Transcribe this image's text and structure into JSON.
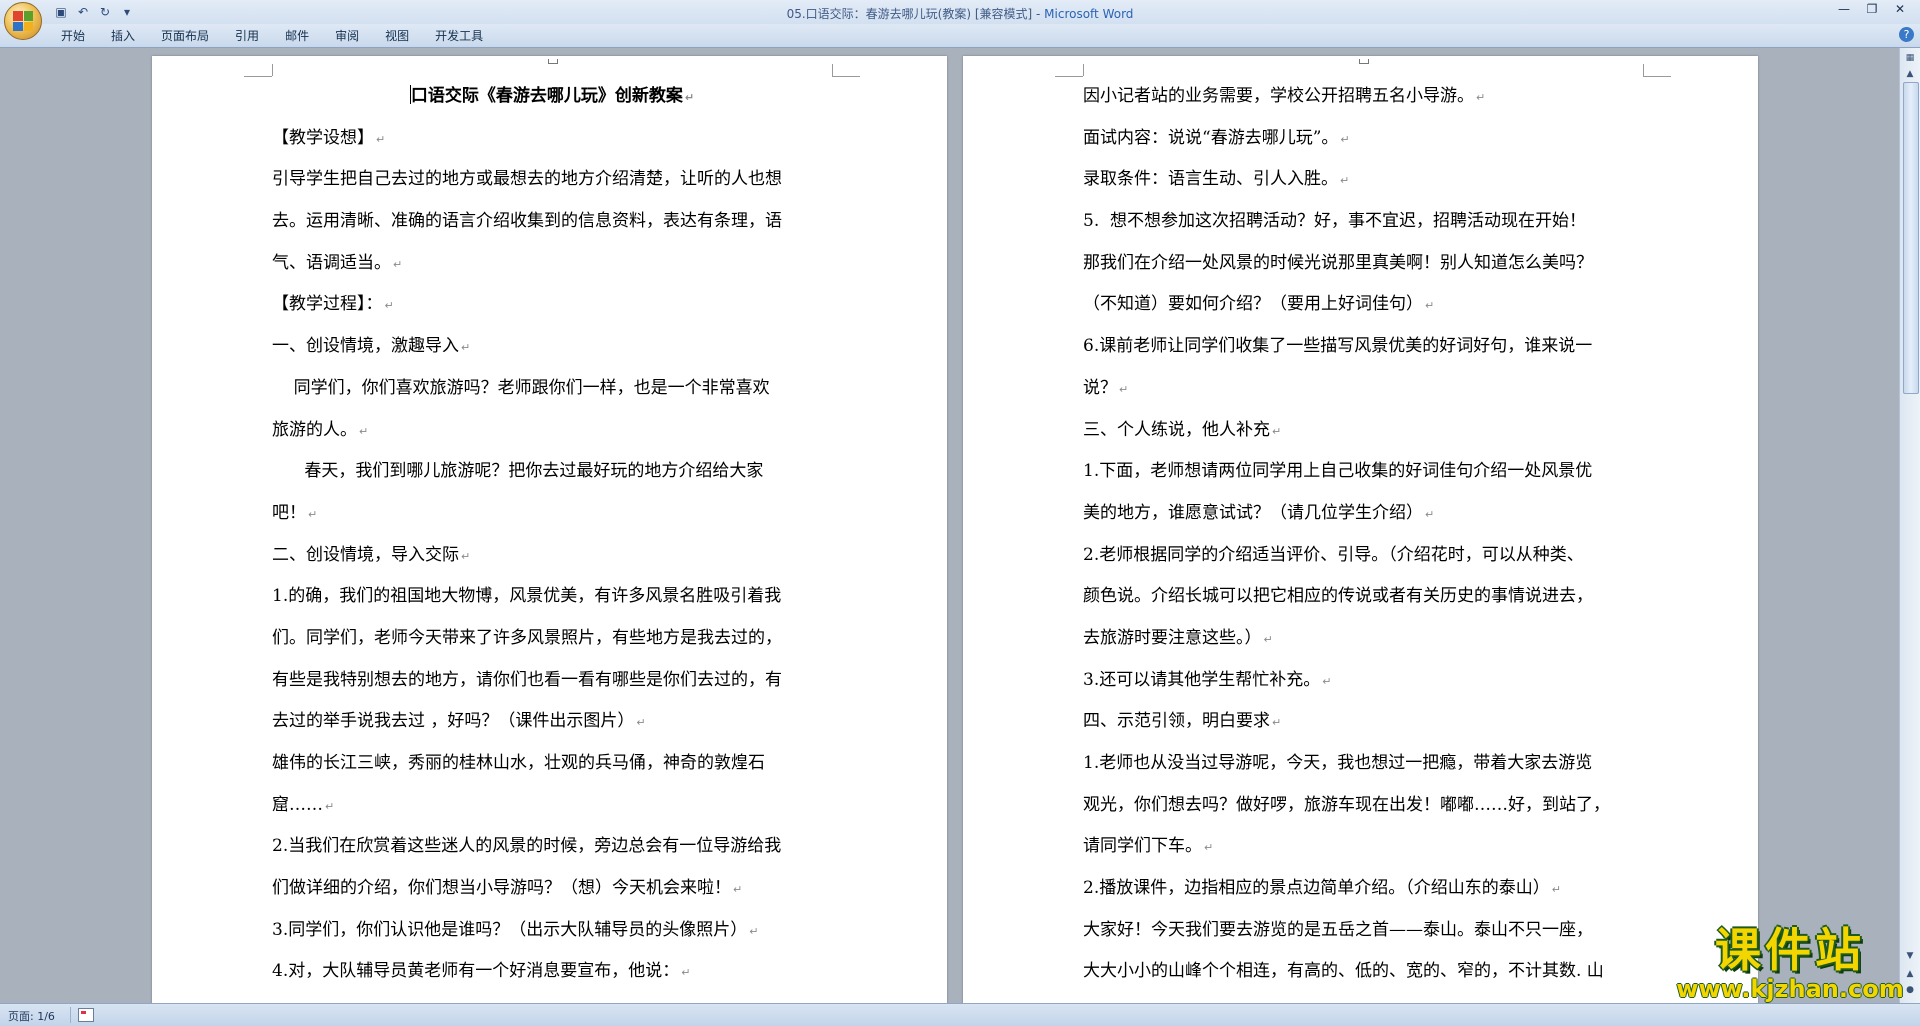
{
  "window": {
    "doc_title": "05.口语交际：春游去哪儿玩(教案) [兼容模式] - ",
    "app_name": "Microsoft Word"
  },
  "qat": {
    "save_icon": "save-icon",
    "undo_icon": "undo-icon",
    "redo_icon": "redo-icon"
  },
  "ribbon": {
    "tabs": [
      "开始",
      "插入",
      "页面布局",
      "引用",
      "邮件",
      "审阅",
      "视图",
      "开发工具"
    ]
  },
  "page_left": {
    "lines": [
      "口语交际《春游去哪儿玩》创新教案",
      "【教学设想】",
      "引导学生把自己去过的地方或最想去的地方介绍清楚，让听的人也想",
      "去。运用清晰、准确的语言介绍收集到的信息资料，表达有条理，语",
      "气、语调适当。",
      "【教学过程】：",
      "一、创设情境，激趣导入",
      "    同学们，你们喜欢旅游吗？老师跟你们一样，也是一个非常喜欢",
      "旅游的人。",
      "      春天，我们到哪儿旅游呢？把你去过最好玩的地方介绍给大家",
      "吧！",
      "二、创设情境，导入交际",
      "1.的确，我们的祖国地大物博，风景优美，有许多风景名胜吸引着我",
      "们。同学们，老师今天带来了许多风景照片，有些地方是我去过的，",
      "有些是我特别想去的地方，请你们也看一看有哪些是你们去过的，有",
      "去过的举手说我去过 ，好吗？（课件出示图片）",
      "雄伟的长江三峡，秀丽的桂林山水，壮观的兵马俑，神奇的敦煌石",
      "窟……",
      "2.当我们在欣赏着这些迷人的风景的时候，旁边总会有一位导游给我",
      "们做详细的介绍，你们想当小导游吗？（想）今天机会来啦！",
      "3.同学们，你们认识他是谁吗？（出示大队辅导员的头像照片）",
      "4.对，大队辅导员黄老师有一个好消息要宣布，他说："
    ]
  },
  "page_right": {
    "lines": [
      "因小记者站的业务需要，学校公开招聘五名小导游。",
      "面试内容：说说“春游去哪儿玩”。",
      "录取条件：语言生动、引人入胜。",
      "5.  想不想参加这次招聘活动？好，事不宜迟，招聘活动现在开始！",
      "那我们在介绍一处风景的时候光说那里真美啊！别人知道怎么美吗？",
      "（不知道）要如何介绍？（要用上好词佳句）",
      "6.课前老师让同学们收集了一些描写风景优美的好词好句，谁来说一",
      "说？",
      "三、个人练说，他人补充",
      "1.下面，老师想请两位同学用上自己收集的好词佳句介绍一处风景优",
      "美的地方，谁愿意试试？（请几位学生介绍）",
      "2.老师根据同学的介绍适当评价、引导。（介绍花时，可以从种类、",
      "颜色说。介绍长城可以把它相应的传说或者有关历史的事情说进去，",
      "去旅游时要注意这些。）",
      "3.还可以请其他学生帮忙补充。",
      "四、示范引领，明白要求",
      "1.老师也从没当过导游呢，今天，我也想过一把瘾，带着大家去游览",
      "观光，你们想去吗？做好啰，旅游车现在出发！嘟嘟……好，到站了，",
      "请同学们下车。",
      "2.播放课件，边指相应的景点边简单介绍。（介绍山东的泰山）",
      "大家好！今天我们要去游览的是五岳之首——泰山。泰山不只一座，",
      "大大小小的山峰个个相连，有高的、低的、宽的、窄的，不计其数. 山"
    ]
  },
  "statusbar": {
    "page_info": "页面: 1/6"
  },
  "watermark": {
    "title": "课件站",
    "url": "www.kjzhan.com"
  },
  "colors": {
    "ribbon_bg": "#c9d9ec",
    "workspace_bg": "#a9b1bd",
    "watermark_fill": "#f3d500",
    "watermark_stroke": "#1f5b1f"
  }
}
